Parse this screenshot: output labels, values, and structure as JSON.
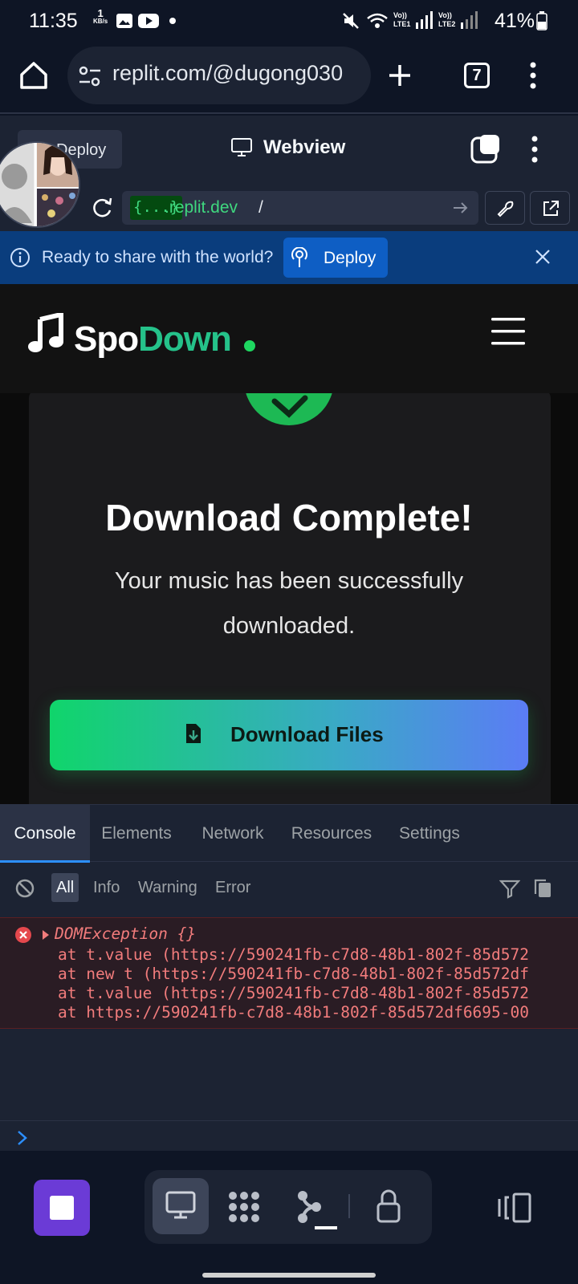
{
  "status_bar": {
    "time": "11:35",
    "speed_value": "1",
    "speed_unit": "KB/s",
    "battery_percent": "41%"
  },
  "browser": {
    "url": "replit.com/@dugong030",
    "tab_count": "7"
  },
  "replit": {
    "deploy_chip_label": "Deploy",
    "webview_title": "Webview",
    "address_tag": "{...}",
    "address_domain": ".replit.dev",
    "address_path": "/"
  },
  "share_banner": {
    "text": "Ready to share with the world?",
    "deploy_label": "Deploy"
  },
  "app": {
    "logo_part1": "Spo",
    "logo_part2": "Down",
    "title": "Download Complete!",
    "subtitle": "Your music has been successfully downloaded.",
    "download_button": "Download Files"
  },
  "devtools": {
    "tabs": [
      "Console",
      "Elements",
      "Network",
      "Resources",
      "Settings"
    ],
    "filters": [
      "All",
      "Info",
      "Warning",
      "Error"
    ],
    "log": {
      "title": "DOMException {}",
      "lines": [
        "at t.value (https://590241fb-c7d8-48b1-802f-85d572",
        "at new t (https://590241fb-c7d8-48b1-802f-85d572df",
        "at t.value (https://590241fb-c7d8-48b1-802f-85d572",
        "at https://590241fb-c7d8-48b1-802f-85d572df6695-00"
      ]
    }
  },
  "colors": {
    "brand_green": "#1db954",
    "accent_blue": "#2c8fff",
    "stop_purple": "#6b3bd6",
    "error_red": "#f27c7c"
  }
}
